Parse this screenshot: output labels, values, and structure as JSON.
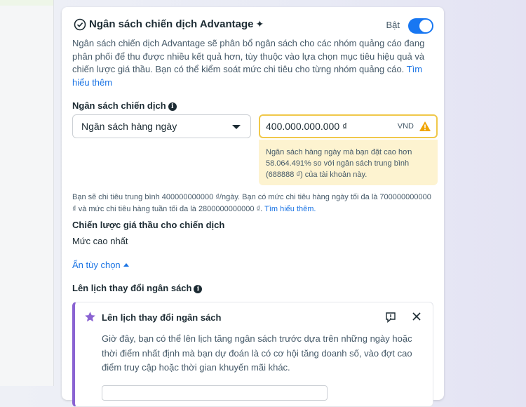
{
  "header": {
    "title": "Ngân sách chiến dịch Advantage",
    "toggle_label": "Bật",
    "toggle_on": true,
    "icon": "check-circle-icon",
    "title_mark_icon": "sparkle-icon"
  },
  "description": {
    "text": "Ngân sách chiến dịch Advantage sẽ phân bổ ngân sách cho các nhóm quảng cáo đang phân phối để thu được nhiều kết quả hơn, tùy thuộc vào lựa chọn mục tiêu hiệu quả và chiến lược giá thầu. Bạn có thể kiểm soát mức chi tiêu cho từng nhóm quảng cáo.",
    "link": "Tìm hiểu thêm"
  },
  "budget": {
    "label": "Ngân sách chiến dịch",
    "type_value": "Ngân sách hàng ngày",
    "amount_value": "400.000.000.000 ₫",
    "currency": "VND",
    "warning": "Ngân sách hàng ngày mà bạn đặt cao hơn 58.064.491% so với ngân sách trung bình (688888 ₫) của tài khoản này."
  },
  "spend_note": {
    "text": "Bạn sẽ chi tiêu trung bình 400000000000 ₫/ngày. Bạn có mức chi tiêu hàng ngày tối đa là 700000000000 ₫ và mức chi tiêu hàng tuần tối đa là 2800000000000 ₫.",
    "link": "Tìm hiểu thêm."
  },
  "bid_strategy": {
    "label": "Chiến lược giá thầu cho chiến dịch",
    "value": "Mức cao nhất"
  },
  "hide_options": "Ẩn tùy chọn",
  "schedule": {
    "label": "Lên lịch thay đổi ngân sách"
  },
  "notice": {
    "title": "Lên lịch thay đổi ngân sách",
    "body": "Giờ đây, bạn có thể lên lịch tăng ngân sách trước dựa trên những ngày hoặc thời điểm nhất định mà bạn dự đoán là có cơ hội tăng doanh số, vào đợt cao điểm truy cập hoặc thời gian khuyến mãi khác.",
    "icons": [
      "star-icon",
      "feedback-icon",
      "close-icon"
    ]
  },
  "colors": {
    "accent": "#1877f2",
    "link": "#1b74e4",
    "warning_border": "#f0c84a",
    "warning_bg": "#fdf3d0",
    "notice_accent": "#8a63d2"
  }
}
